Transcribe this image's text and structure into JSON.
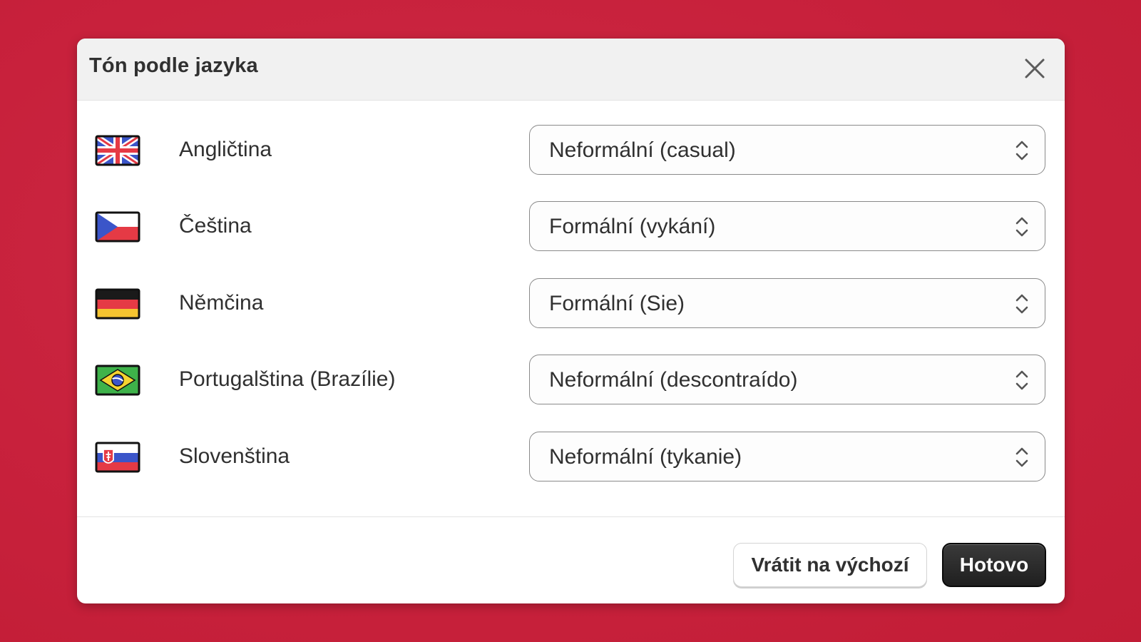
{
  "dialog": {
    "title": "Tón podle jazyka",
    "close_icon": "close-icon"
  },
  "languages": [
    {
      "name": "Angličtina",
      "flag": "uk-flag-icon",
      "tone": "Neformální (casual)"
    },
    {
      "name": "Čeština",
      "flag": "czech-flag-icon",
      "tone": "Formální (vykání)"
    },
    {
      "name": "Němčina",
      "flag": "germany-flag-icon",
      "tone": "Formální (Sie)"
    },
    {
      "name": "Portugalština (Brazílie)",
      "flag": "brazil-flag-icon",
      "tone": "Neformální (descontraído)"
    },
    {
      "name": "Slovenština",
      "flag": "slovakia-flag-icon",
      "tone": "Neformální (tykanie)"
    }
  ],
  "footer": {
    "reset_label": "Vrátit na výchozí",
    "done_label": "Hotovo"
  },
  "colors": {
    "background": "#c8213c",
    "primary_button": "#2b2b2b",
    "header_bg": "#f1f1f1"
  }
}
